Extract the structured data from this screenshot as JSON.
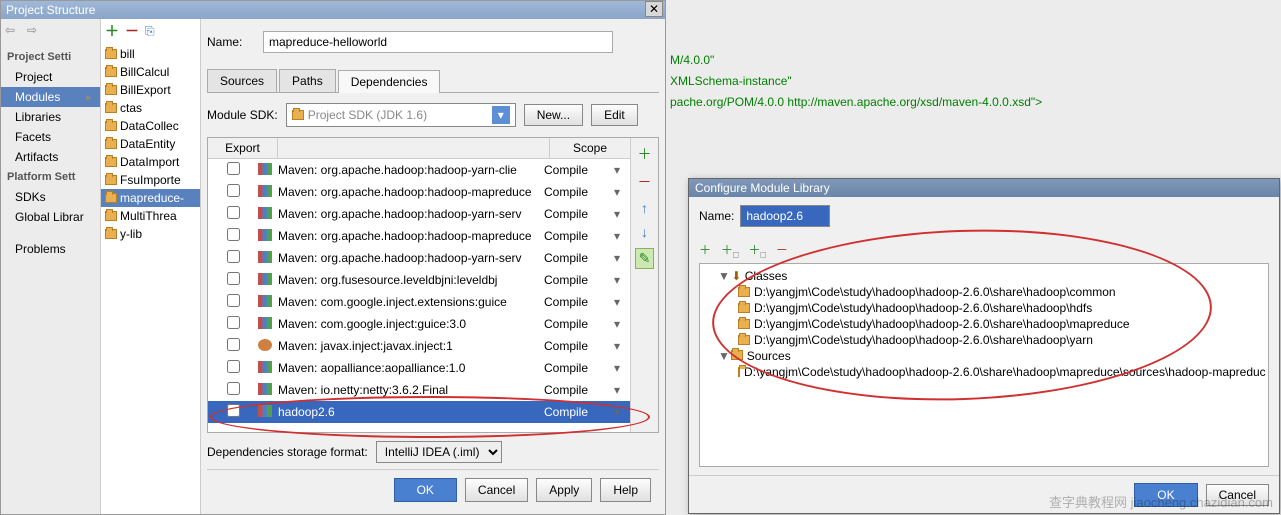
{
  "projectStructure": {
    "title": "Project Structure",
    "nameLabel": "Name:",
    "nameValue": "mapreduce-helloworld",
    "sections": {
      "projectSettings": "Project Setti",
      "platformSettings": "Platform Sett"
    },
    "leftItems": [
      "Project",
      "Modules",
      "Libraries",
      "Facets",
      "Artifacts"
    ],
    "platformItems": [
      "SDKs",
      "Global Librar"
    ],
    "problems": "Problems",
    "modules": [
      "bill",
      "BillCalcul",
      "BillExport",
      "ctas",
      "DataCollec",
      "DataEntity",
      "DataImport",
      "FsuImporte",
      "mapreduce-",
      "MultiThrea",
      "y-lib"
    ],
    "selectedModule": 8,
    "tabs": [
      "Sources",
      "Paths",
      "Dependencies"
    ],
    "activeTab": 2,
    "sdkLabel": "Module SDK:",
    "sdkValue": "Project SDK (JDK 1.6)",
    "newBtn": "New...",
    "editBtn": "Edit",
    "depHeader": {
      "export": "Export",
      "scope": "Scope"
    },
    "deps": [
      {
        "name": "Maven: org.apache.hadoop:hadoop-yarn-clie",
        "scope": "Compile",
        "type": "maven"
      },
      {
        "name": "Maven: org.apache.hadoop:hadoop-mapreduce",
        "scope": "Compile",
        "type": "maven"
      },
      {
        "name": "Maven: org.apache.hadoop:hadoop-yarn-serv",
        "scope": "Compile",
        "type": "maven"
      },
      {
        "name": "Maven: org.apache.hadoop:hadoop-mapreduce",
        "scope": "Compile",
        "type": "maven"
      },
      {
        "name": "Maven: org.apache.hadoop:hadoop-yarn-serv",
        "scope": "Compile",
        "type": "maven"
      },
      {
        "name": "Maven: org.fusesource.leveldbjni:leveldbj",
        "scope": "Compile",
        "type": "maven"
      },
      {
        "name": "Maven: com.google.inject.extensions:guice",
        "scope": "Compile",
        "type": "maven"
      },
      {
        "name": "Maven: com.google.inject:guice:3.0",
        "scope": "Compile",
        "type": "maven"
      },
      {
        "name": "Maven: javax.inject:javax.inject:1",
        "scope": "Compile",
        "type": "mavenAlt"
      },
      {
        "name": "Maven: aopalliance:aopalliance:1.0",
        "scope": "Compile",
        "type": "maven"
      },
      {
        "name": "Maven: io.netty:netty:3.6.2.Final",
        "scope": "Compile",
        "type": "maven"
      },
      {
        "name": "hadoop2.6",
        "scope": "Compile",
        "type": "lib",
        "selected": true
      }
    ],
    "storageLabel": "Dependencies storage format:",
    "storageValue": "IntelliJ IDEA (.iml)",
    "buttons": {
      "ok": "OK",
      "cancel": "Cancel",
      "apply": "Apply",
      "help": "Help"
    }
  },
  "editorLines": [
    "M/4.0.0\"",
    "XMLSchema-instance\"",
    "pache.org/POM/4.0.0 http://maven.apache.org/xsd/maven-4.0.0.xsd\">"
  ],
  "configLib": {
    "title": "Configure Module Library",
    "nameLabel": "Name:",
    "nameValue": "hadoop2.6",
    "classesLabel": "Classes",
    "sourcesLabel": "Sources",
    "classPaths": [
      "D:\\yangjm\\Code\\study\\hadoop\\hadoop-2.6.0\\share\\hadoop\\common",
      "D:\\yangjm\\Code\\study\\hadoop\\hadoop-2.6.0\\share\\hadoop\\hdfs",
      "D:\\yangjm\\Code\\study\\hadoop\\hadoop-2.6.0\\share\\hadoop\\mapreduce",
      "D:\\yangjm\\Code\\study\\hadoop\\hadoop-2.6.0\\share\\hadoop\\yarn"
    ],
    "sourcePaths": [
      "D:\\yangjm\\Code\\study\\hadoop\\hadoop-2.6.0\\share\\hadoop\\mapreduce\\sources\\hadoop-mapreduc"
    ],
    "buttons": {
      "ok": "OK",
      "cancel": "Cancel"
    }
  },
  "watermark": "查字典教程网 jiaocheng.chazidian.com"
}
